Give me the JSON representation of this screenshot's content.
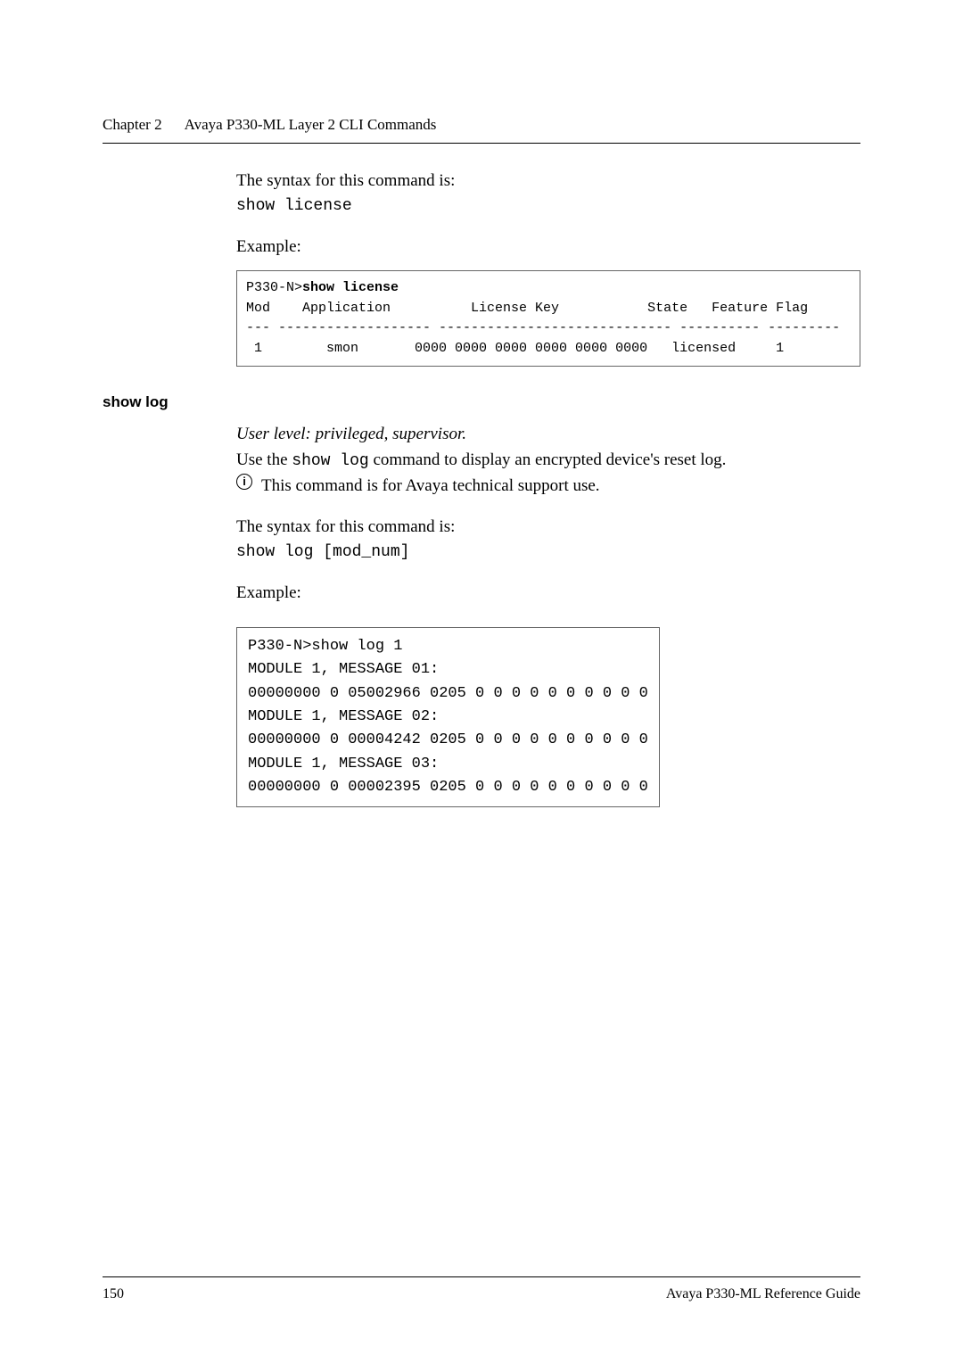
{
  "header": {
    "chapter_label": "Chapter 2",
    "chapter_title": "Avaya P330-ML Layer 2 CLI Commands"
  },
  "section1": {
    "syntax_intro": "The syntax for this command is:",
    "syntax_cmd": "show license",
    "example_label": "Example:",
    "code_prompt": "P330-N>",
    "code_cmd": "show license",
    "code_header": "Mod    Application          License Key           State   Feature Flag",
    "code_divider": "--- ------------------- ----------------------------- ---------- ---------",
    "code_row": " 1        smon       0000 0000 0000 0000 0000 0000   licensed     1"
  },
  "section2": {
    "heading": "show log",
    "user_level": "User level: privileged, supervisor.",
    "desc_pre": "Use the ",
    "desc_mono": "show log",
    "desc_post": " command to display an encrypted device's reset log.",
    "info_icon_char": "i",
    "info_text": "This command is for Avaya technical support use.",
    "syntax_intro": "The syntax for this command is:",
    "syntax_cmd": "show log [mod_num]",
    "example_label": "Example:",
    "code_prompt": "P330-N>",
    "code_cmd": "show log 1",
    "line1": "MODULE 1, MESSAGE 01:",
    "line2": "00000000 0 05002966 0205 0 0 0 0 0 0 0 0 0 0",
    "line3": "MODULE 1, MESSAGE 02:",
    "line4": "00000000 0 00004242 0205 0 0 0 0 0 0 0 0 0 0",
    "line5": "MODULE 1, MESSAGE 03:",
    "line6": "00000000 0 00002395 0205 0 0 0 0 0 0 0 0 0 0"
  },
  "footer": {
    "page_num": "150",
    "doc_title": "Avaya P330-ML Reference Guide"
  }
}
